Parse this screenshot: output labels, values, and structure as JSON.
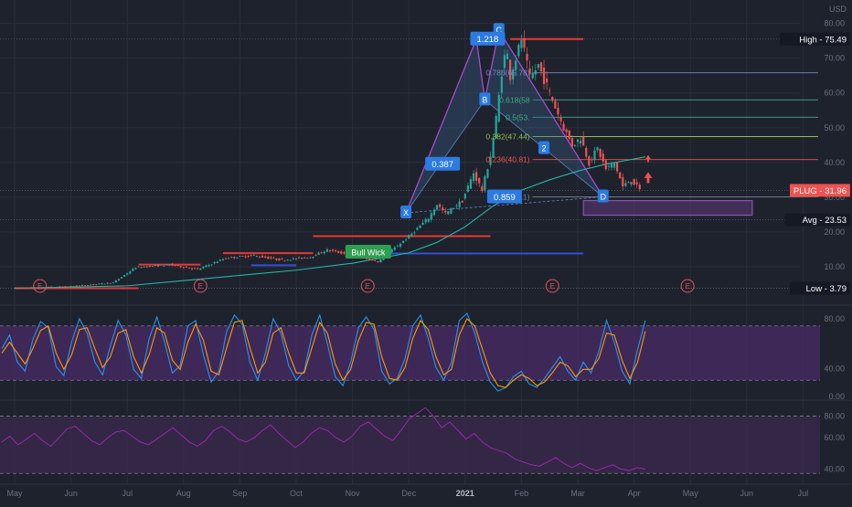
{
  "colors": {
    "background": "#1e222d",
    "grid": "#2a2e39",
    "axis_text": "#6b7080",
    "candle_up": "#26a69a",
    "candle_down": "#ef5350",
    "ema": "#26b5a8",
    "harmonic_fill": "#3a5f8a",
    "harmonic_line": "#b04ad8",
    "label_blue": "#2b7be3",
    "stoch_k": "#2196f3",
    "stoch_d": "#ff9800",
    "stoch_band": "#4a2b66",
    "rsi_line": "#9c27b0",
    "rsi_band": "#3b2a4e",
    "resistance": "#e53935",
    "support": "#2e4fd8",
    "price_badge": "#ef5350",
    "target_box": "#5e3a7c"
  },
  "chart_data": [
    {
      "type": "candlestick",
      "ticker": "PLUG",
      "currency": "USD",
      "x_months": [
        "May",
        "Jun",
        "Jul",
        "Aug",
        "Sep",
        "Oct",
        "Nov",
        "Dec",
        "2021",
        "Feb",
        "Mar",
        "Apr",
        "May",
        "Jun",
        "Jul"
      ],
      "ylim": [
        0,
        82
      ],
      "y_ticks": [
        10,
        20,
        30,
        40,
        50,
        60,
        70,
        80
      ],
      "y_tick_labels": [
        "10.00",
        "20.00",
        "30.00",
        "40.00",
        "50.00",
        "60.00",
        "70.00",
        "80.00"
      ],
      "grid": true,
      "price_path": [
        [
          0,
          3.8
        ],
        [
          1,
          4.3
        ],
        [
          1.8,
          5.4
        ],
        [
          2.2,
          9.8
        ],
        [
          2.8,
          10.6
        ],
        [
          3.3,
          9.2
        ],
        [
          3.8,
          12.5
        ],
        [
          4.3,
          13.2
        ],
        [
          4.8,
          11.9
        ],
        [
          5.3,
          12.8
        ],
        [
          5.6,
          14.8
        ],
        [
          6.0,
          13.5
        ],
        [
          6.5,
          11.5
        ],
        [
          7.0,
          18.0
        ],
        [
          7.4,
          24.0
        ],
        [
          7.55,
          28.0
        ],
        [
          7.7,
          25.2
        ],
        [
          8.0,
          29.0
        ],
        [
          8.2,
          37.0
        ],
        [
          8.35,
          32.0
        ],
        [
          8.5,
          42.0
        ],
        [
          8.55,
          47.0
        ],
        [
          8.62,
          55.0
        ],
        [
          8.7,
          66.0
        ],
        [
          8.78,
          73.0
        ],
        [
          8.85,
          65.0
        ],
        [
          8.95,
          70.0
        ],
        [
          9.05,
          75.5
        ],
        [
          9.2,
          64.0
        ],
        [
          9.35,
          68.0
        ],
        [
          9.5,
          62.0
        ],
        [
          9.65,
          56.0
        ],
        [
          9.8,
          50.0
        ],
        [
          9.95,
          45.0
        ],
        [
          10.1,
          47.0
        ],
        [
          10.25,
          40.0
        ],
        [
          10.4,
          44.0
        ],
        [
          10.55,
          38.0
        ],
        [
          10.7,
          40.0
        ],
        [
          10.85,
          33.0
        ],
        [
          11.0,
          35.0
        ],
        [
          11.15,
          31.96
        ]
      ],
      "ema": [
        [
          0,
          3.8
        ],
        [
          2,
          4.5
        ],
        [
          3,
          6.0
        ],
        [
          4,
          7.5
        ],
        [
          5,
          9.0
        ],
        [
          6,
          11.0
        ],
        [
          7,
          14.0
        ],
        [
          7.5,
          17.0
        ],
        [
          8,
          21.5
        ],
        [
          8.5,
          27.5
        ],
        [
          9,
          32.0
        ],
        [
          9.5,
          35.0
        ],
        [
          10,
          37.5
        ],
        [
          10.5,
          39.5
        ],
        [
          11,
          41.0
        ],
        [
          11.2,
          41.6
        ]
      ],
      "price_lines": [
        {
          "label": "High",
          "value": 75.49,
          "text": "High - 75.49"
        },
        {
          "label": "PLUG",
          "value": 31.96,
          "text": "PLUG - 31.96"
        },
        {
          "label": "Avg",
          "value": 23.53,
          "text": "Avg - 23.53"
        },
        {
          "label": "Low",
          "value": 3.79,
          "text": "Low - 3.79"
        }
      ],
      "fib_levels": [
        {
          "text": "0.786(65.78)",
          "value": 65.78
        },
        {
          "text": "0.618(58",
          "value": 58.0
        },
        {
          "text": "0.5(53.",
          "value": 53.0
        },
        {
          "text": "0.382(47.44)",
          "value": 47.44
        },
        {
          "text": "0.236(40.81)",
          "value": 40.81
        },
        {
          "text": "0(30.1)",
          "value": 30.1
        }
      ],
      "fib_top_text": "1",
      "resistance_lines": [
        {
          "x0": 0,
          "x1": 2.2,
          "value": 3.8
        },
        {
          "x0": 2.2,
          "x1": 3.3,
          "value": 10.6
        },
        {
          "x0": 3.7,
          "x1": 5.3,
          "value": 13.9
        },
        {
          "x0": 5.3,
          "x1": 8.45,
          "value": 18.8
        },
        {
          "x0": 8.8,
          "x1": 10.1,
          "value": 75.49
        }
      ],
      "support_lines": [
        {
          "x0": 4.2,
          "x1": 5.0,
          "value": 10.4
        },
        {
          "x0": 6.2,
          "x1": 10.1,
          "value": 13.8
        }
      ],
      "target_zone": {
        "x0": 10.1,
        "x1": 13.1,
        "y_low": 24.8,
        "y_high": 29.0
      },
      "harmonic_points": [
        {
          "label": "X",
          "x": 6.95,
          "y": 25.5
        },
        {
          "label": "A",
          "x": 8.2,
          "y": 75.5
        },
        {
          "label": "B",
          "x": 8.35,
          "y": 58.0
        },
        {
          "label": "C",
          "x": 8.6,
          "y": 78.0
        },
        {
          "label": "D",
          "x": 10.45,
          "y": 30.1
        }
      ],
      "pattern_labels": [
        {
          "text": "0.387",
          "x": 7.6,
          "value": 39.5
        },
        {
          "text": "1.218",
          "x": 8.4,
          "value": 75.5
        },
        {
          "text": "0.859",
          "x": 8.7,
          "value": 30.1
        }
      ],
      "wave_labels": [
        {
          "text": "2",
          "x": 9.4,
          "value": 44.0
        }
      ],
      "annotation": {
        "text": "Bull Wick",
        "x": 6.28,
        "value": 14.2
      },
      "earnings_markers": [
        {
          "text": "E",
          "x": 0.45
        },
        {
          "text": "E",
          "x": 3.3
        },
        {
          "text": "E",
          "x": 6.27
        },
        {
          "text": "E",
          "x": 9.55
        },
        {
          "text": "E",
          "x": 11.95
        }
      ],
      "up_arrows": [
        {
          "x": 11.25,
          "value": 41.0
        },
        {
          "x": 11.25,
          "value": 35.5
        }
      ]
    },
    {
      "type": "line",
      "name": "stochastic",
      "ylim": [
        0,
        100
      ],
      "band": [
        20,
        80
      ],
      "y_tick_labels": [
        "80.00",
        "40.00",
        "0.00"
      ],
      "series": [
        {
          "key": "k",
          "values": [
            55,
            70,
            40,
            30,
            65,
            85,
            78,
            35,
            25,
            62,
            88,
            72,
            40,
            26,
            58,
            86,
            70,
            32,
            22,
            66,
            90,
            62,
            28,
            36,
            80,
            86,
            48,
            18,
            30,
            74,
            92,
            82,
            40,
            20,
            50,
            88,
            72,
            36,
            20,
            30,
            70,
            92,
            60,
            24,
            14,
            40,
            78,
            90,
            76,
            30,
            16,
            22,
            44,
            80,
            92,
            66,
            34,
            20,
            40,
            86,
            94,
            72,
            40,
            18,
            8,
            12,
            24,
            30,
            16,
            12,
            22,
            34,
            46,
            30,
            20,
            40,
            28,
            52,
            86,
            62,
            30,
            16,
            54,
            86
          ]
        },
        {
          "key": "d",
          "values": [
            50,
            62,
            50,
            38,
            55,
            75,
            80,
            50,
            32,
            48,
            76,
            78,
            55,
            34,
            46,
            72,
            76,
            46,
            28,
            48,
            78,
            72,
            42,
            32,
            62,
            82,
            64,
            30,
            26,
            56,
            84,
            86,
            56,
            28,
            40,
            72,
            78,
            50,
            28,
            28,
            56,
            84,
            72,
            38,
            20,
            32,
            64,
            84,
            82,
            46,
            22,
            20,
            34,
            66,
            86,
            76,
            46,
            26,
            32,
            70,
            88,
            80,
            54,
            28,
            14,
            12,
            20,
            26,
            22,
            14,
            18,
            28,
            40,
            36,
            24,
            32,
            32,
            44,
            72,
            70,
            42,
            22,
            40,
            74
          ]
        }
      ]
    },
    {
      "type": "line",
      "name": "rsi",
      "ylim": [
        25,
        80
      ],
      "band": [
        30,
        70
      ],
      "y_tick_labels": [
        "80.00",
        "60.00",
        "40.00"
      ],
      "values": [
        52,
        56,
        50,
        54,
        58,
        53,
        49,
        55,
        61,
        63,
        58,
        53,
        50,
        55,
        59,
        60,
        56,
        52,
        50,
        54,
        58,
        62,
        57,
        52,
        49,
        53,
        60,
        63,
        59,
        54,
        52,
        55,
        60,
        64,
        58,
        53,
        48,
        52,
        58,
        62,
        60,
        55,
        52,
        56,
        63,
        66,
        61,
        56,
        53,
        60,
        68,
        72,
        76,
        70,
        62,
        66,
        60,
        54,
        58,
        52,
        48,
        46,
        44,
        40,
        38,
        36,
        35,
        38,
        41,
        37,
        34,
        37,
        34,
        32,
        34,
        36,
        33,
        32,
        34,
        33
      ]
    }
  ]
}
